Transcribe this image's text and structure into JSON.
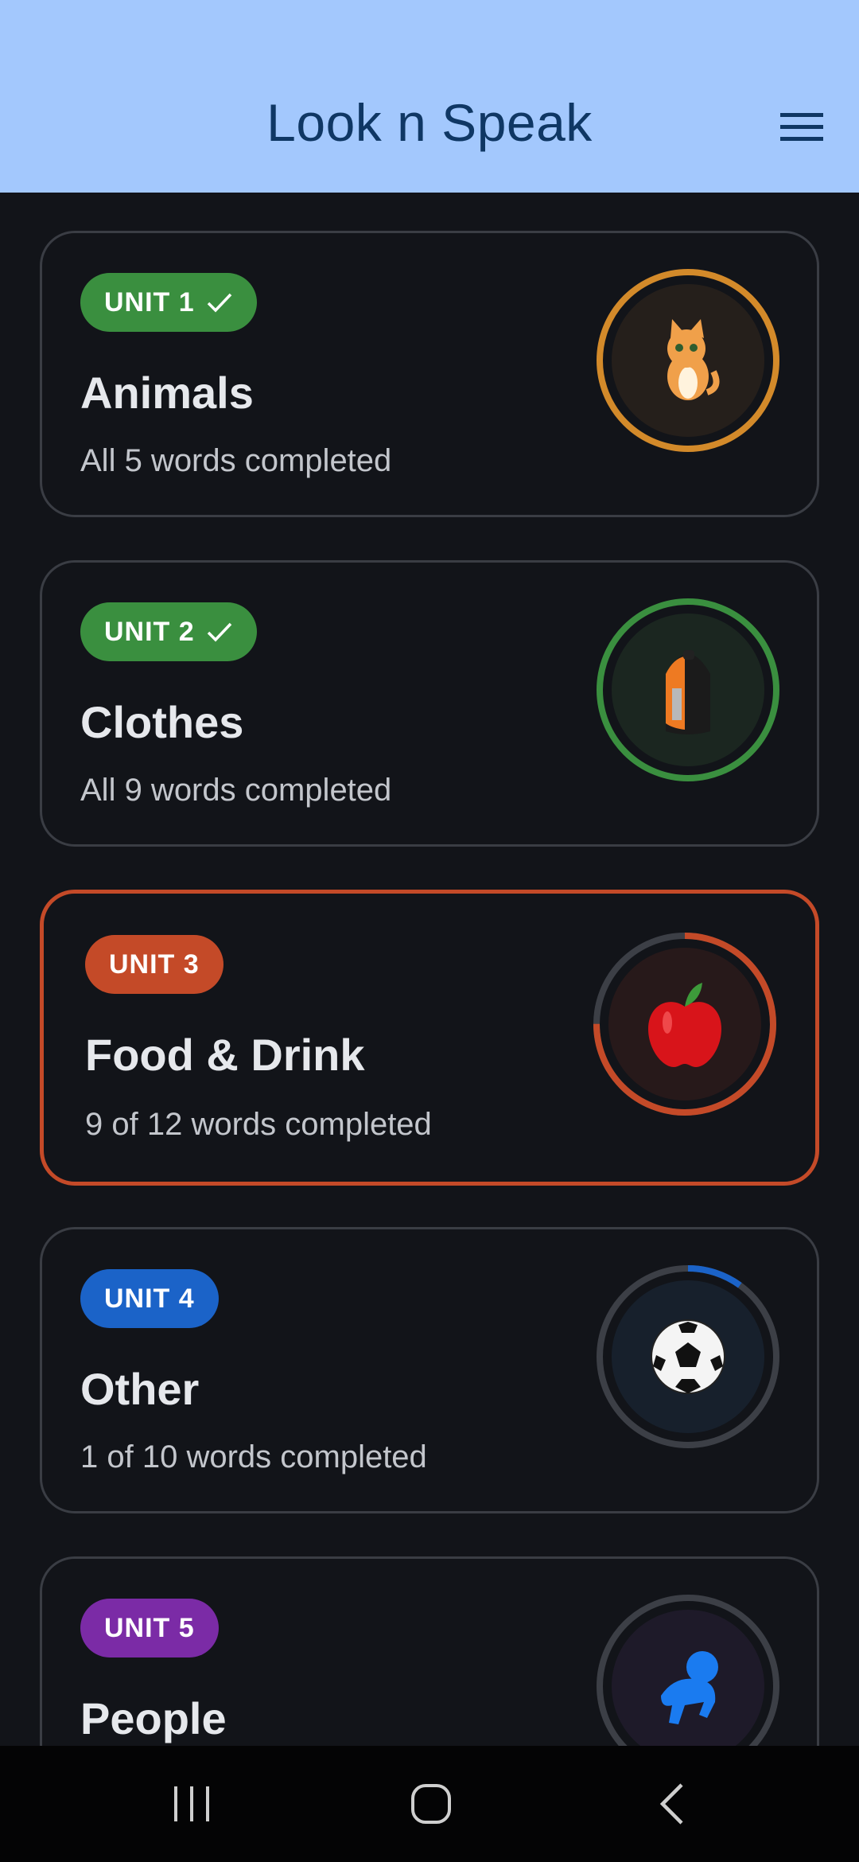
{
  "app": {
    "title": "Look n Speak",
    "menu_icon": "hamburger-menu-icon"
  },
  "units": [
    {
      "badge": "UNIT 1",
      "completed": true,
      "title": "Animals",
      "subtitle": "All 5 words completed",
      "color": "#3a8f3f",
      "ring_color": "#d38a2a",
      "icon": "cat-icon",
      "progress": 1.0
    },
    {
      "badge": "UNIT 2",
      "completed": true,
      "title": "Clothes",
      "subtitle": "All 9 words completed",
      "color": "#3a8f3f",
      "ring_color": "#3a8f3f",
      "icon": "backpack-icon",
      "progress": 1.0
    },
    {
      "badge": "UNIT 3",
      "completed": false,
      "current": true,
      "title": "Food & Drink",
      "subtitle": "9 of 12 words completed",
      "color": "#c44a28",
      "ring_color": "#c44a28",
      "icon": "apple-icon",
      "progress": 0.75
    },
    {
      "badge": "UNIT 4",
      "completed": false,
      "title": "Other",
      "subtitle": "1 of 10 words completed",
      "color": "#1b63c8",
      "ring_color": "#1b63c8",
      "icon": "soccer-ball-icon",
      "progress": 0.1
    },
    {
      "badge": "UNIT 5",
      "completed": false,
      "title": "People",
      "subtitle": "",
      "color": "#7b2ba6",
      "ring_color": "#7b2ba6",
      "icon": "baby-icon",
      "progress": 0.0
    }
  ],
  "navbar": {
    "recents_icon": "recent-apps-icon",
    "home_icon": "home-icon",
    "back_icon": "back-icon"
  }
}
